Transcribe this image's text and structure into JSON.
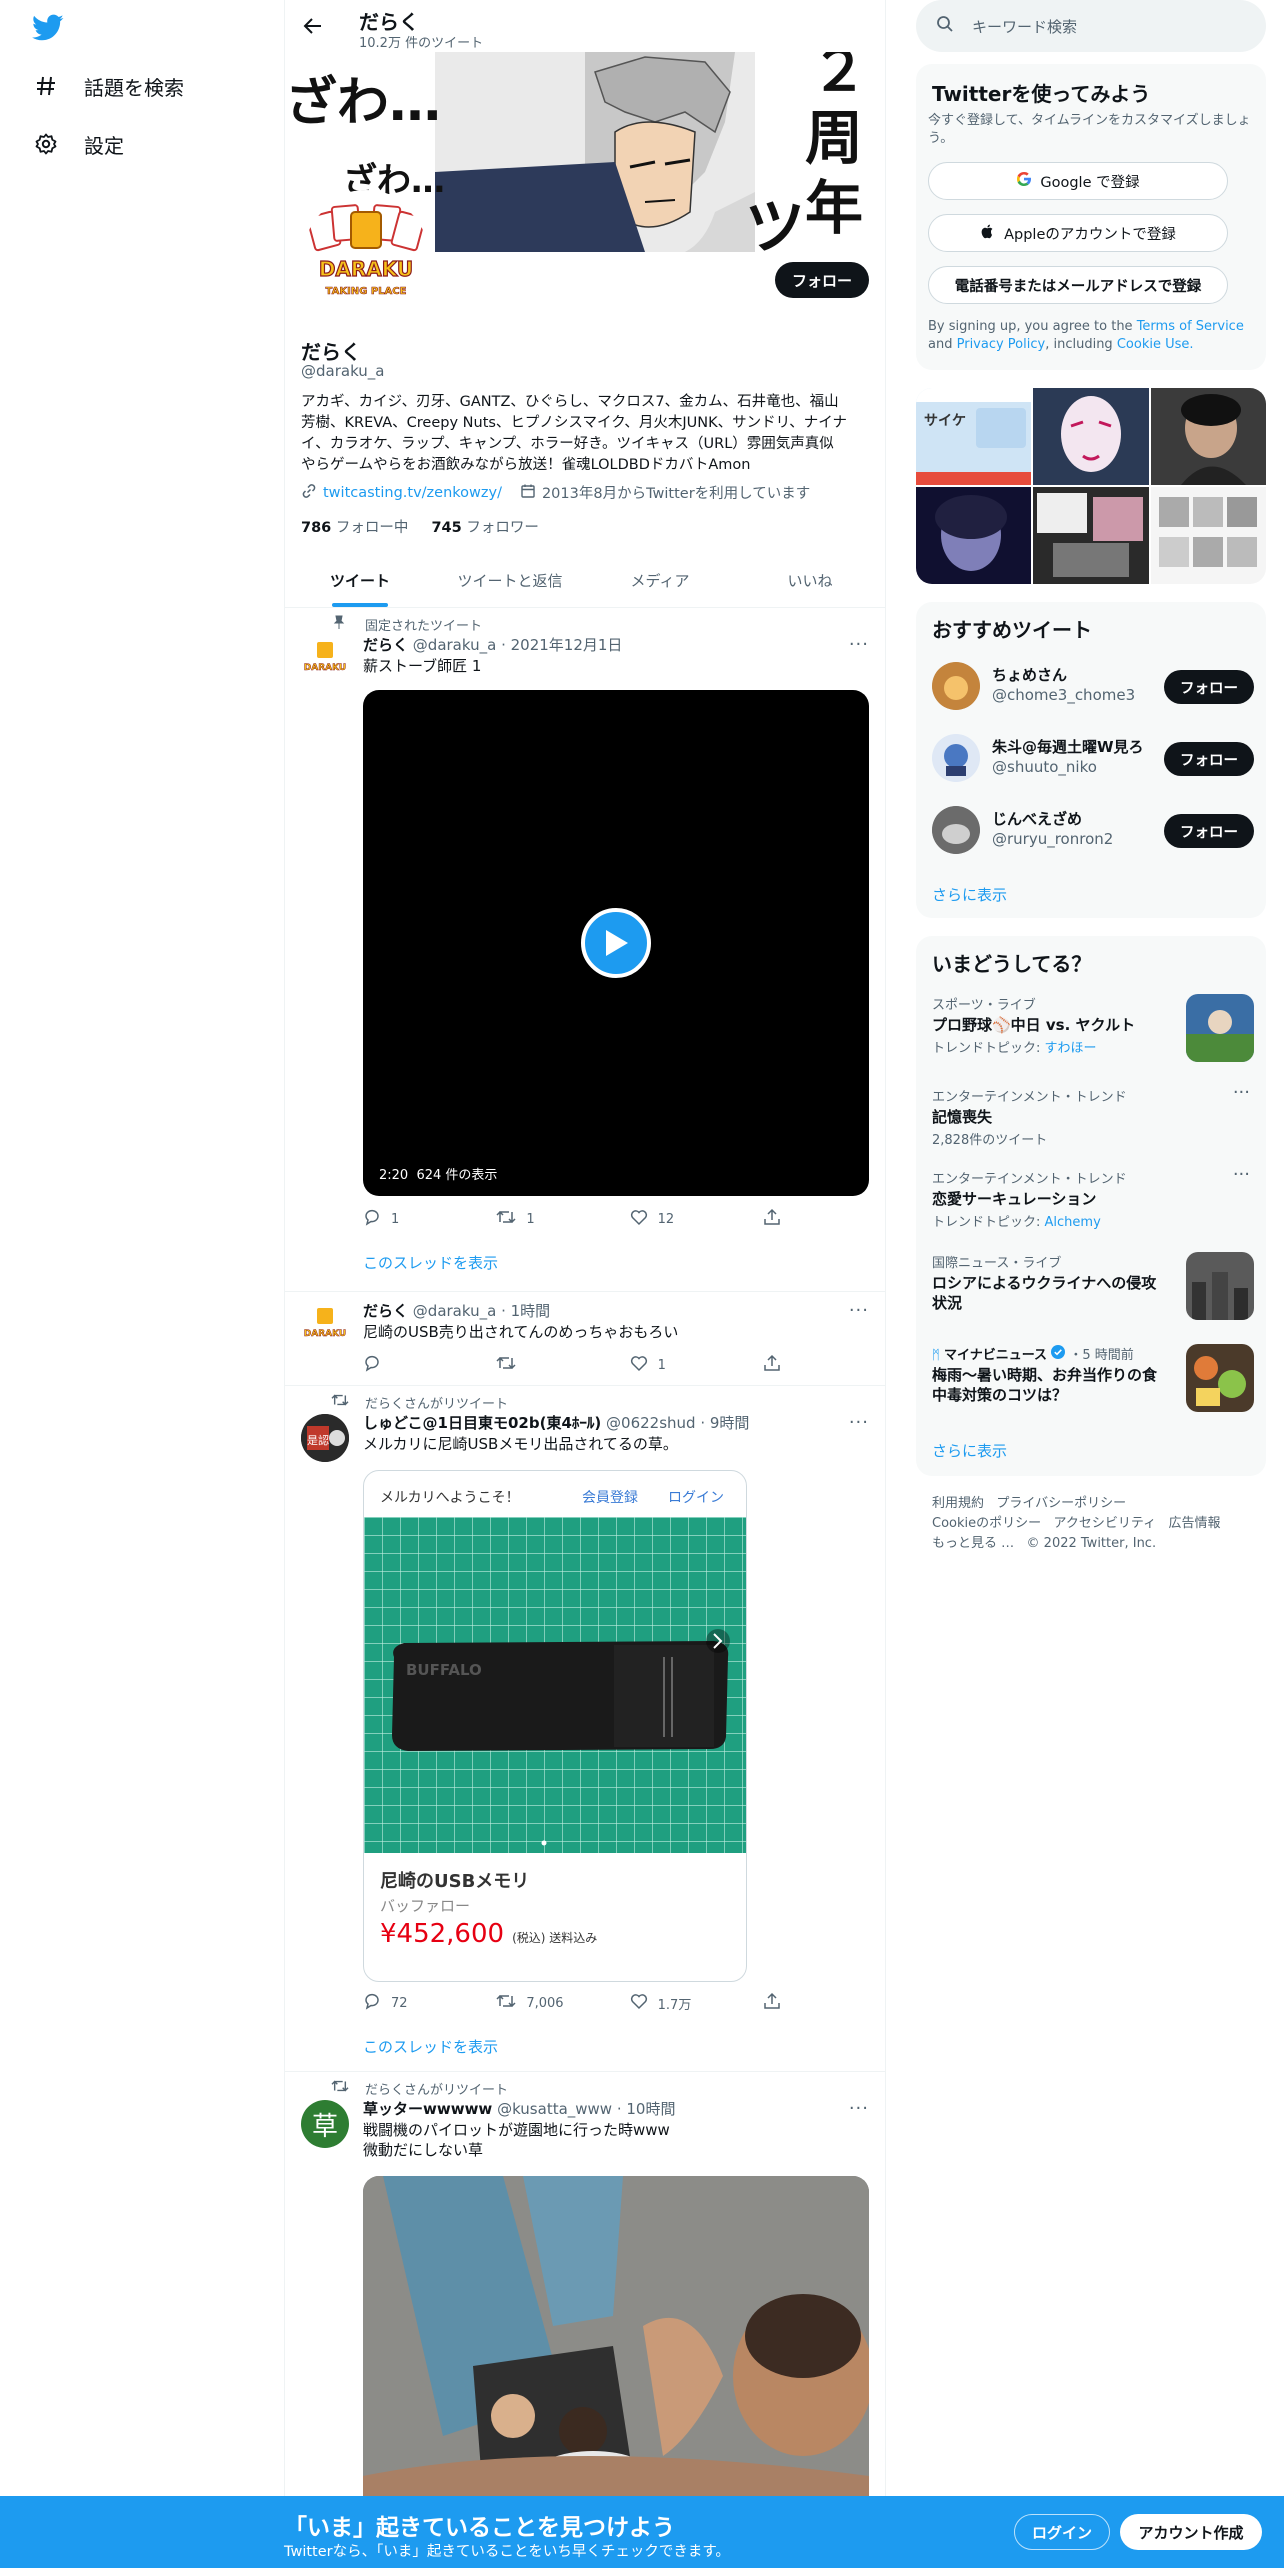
{
  "left_nav": {
    "explore_label": "話題を検索",
    "settings_label": "設定"
  },
  "header": {
    "title": "だらく",
    "tweet_count": "10.2万 件のツイート"
  },
  "banner": {
    "text_left": "ざわ…",
    "text_left2": "ざわ…",
    "text_right_1": "２",
    "text_right_2": "周",
    "text_right_3": "年",
    "text_right_4": "ツ"
  },
  "profile": {
    "logo_text": "DARAKU",
    "logo_sub": "TAKING PLACE",
    "follow_button": "フォロー",
    "name": "だらく",
    "handle": "@daraku_a",
    "bio_lines": [
      "アカギ、カイジ、刃牙、GANTZ、ひぐらし、マクロス7、金カム、石井竜也、福山",
      "芳樹、KREVA、Creepy Nuts、ヒプノシスマイク、月火木JUNK、サンドリ、ナイナ",
      "イ、カラオケ、ラップ、キャンプ、ホラー好き。ツイキャス（URL）雰囲気声真似",
      "やらゲームやらをお酒飲みながら放送！雀魂LOLDBDドカバトAmon"
    ],
    "link": "twitcasting.tv/zenkowzy/",
    "joined": "2013年8月からTwitterを利用しています",
    "following_count": "786",
    "following_label": "フォロー中",
    "followers_count": "745",
    "followers_label": "フォロワー"
  },
  "tabs": [
    "ツイート",
    "ツイートと返信",
    "メディア",
    "いいね"
  ],
  "tweets": [
    {
      "context": "固定されたツイート",
      "name": "だらく",
      "handle": "@daraku_a",
      "time": "2021年12月1日",
      "text": "薪ストーブ師匠 1",
      "video_duration": "2:20",
      "video_views": "624 件の表示",
      "replies": "1",
      "retweets": "1",
      "likes": "12",
      "thread_link": "このスレッドを表示"
    },
    {
      "name": "だらく",
      "handle": "@daraku_a",
      "time": "1時間",
      "text": "尼崎のUSB売り出されてんのめっちゃおもろい",
      "replies": "",
      "retweets": "",
      "likes": "1"
    },
    {
      "context": "だらくさんがリツイート",
      "name": "しゅどこ@1日目東モ02b(東4ﾎｰﾙ)",
      "handle": "@0622shud",
      "time": "9時間",
      "text": "メルカリに尼崎USBメモリ出品されてるの草。",
      "avatar_text": "是認",
      "card": {
        "welcome": "メルカリへようこそ！",
        "signup": "会員登録",
        "login": "ログイン",
        "item_title": "尼崎のUSBメモリ",
        "brand": "バッファロー",
        "price": "¥452,600",
        "price_note": "(税込) 送料込み",
        "usb_brand": "BUFFALO"
      },
      "replies": "72",
      "retweets": "7,006",
      "likes": "1.7万",
      "thread_link": "このスレッドを表示"
    },
    {
      "context": "だらくさんがリツイート",
      "name": "草ッターwwwww",
      "handle": "@kusatta_www",
      "time": "10時間",
      "avatar_text": "草",
      "text_lines": [
        "戦闘機のパイロットが遊園地に行った時www",
        "微動だにしない草"
      ]
    }
  ],
  "right": {
    "search_placeholder": "キーワード検索",
    "signup_card": {
      "title": "Twitterを使ってみよう",
      "subtitle_lines": [
        "今すぐ登録して、タイムラインをカスタマイズしましょ",
        "う。"
      ],
      "google": "Google で登録",
      "apple": "Appleのアカウントで登録",
      "phone": "電話番号またはメールアドレスで登録",
      "terms_prefix": "By signing up, you agree to the",
      "terms_link": "Terms of Service",
      "terms_and": "and",
      "privacy_link": "Privacy Policy",
      "including": ", including",
      "cookie_link": "Cookie Use."
    },
    "media_grid_caption": "サイケ",
    "recommended": {
      "title": "おすすめツイート",
      "users": [
        {
          "name": "ちょめさん",
          "handle": "@chome3_chome3",
          "button": "フォロー"
        },
        {
          "name": "朱斗@毎週土曜W見ろ!",
          "handle": "@shuuto_niko",
          "button": "フォロー"
        },
        {
          "name": "じんべえざめ",
          "handle": "@ruryu_ronron2",
          "button": "フォロー"
        }
      ],
      "more": "さらに表示"
    },
    "trends": {
      "title": "いまどうしてる？",
      "items": [
        {
          "category": "スポーツ・ライブ",
          "title": "プロ野球⚾中日 vs. ヤクルト",
          "sub_prefix": "トレンドトピック:",
          "sub_link": "すわほー"
        },
        {
          "category": "エンターテインメント・トレンド",
          "title": "記憶喪失",
          "sub": "2,828件のツイート"
        },
        {
          "category": "エンターテインメント・トレンド",
          "title": "恋愛サーキュレーション",
          "sub_prefix": "トレンドトピック:",
          "sub_link": "Alchemy"
        },
        {
          "category": "国際ニュース・ライブ",
          "title_lines": [
            "ロシアによるウクライナへの侵攻",
            "状況"
          ]
        },
        {
          "category_name": "マイナビニュース",
          "category_time": "・5 時間前",
          "title_lines": [
            "梅雨～暑い時期、お弁当作りの食",
            "中毒対策のコツは？"
          ]
        }
      ],
      "more": "さらに表示"
    },
    "footer": {
      "line1": [
        "利用規約",
        "プライバシーポリシー"
      ],
      "line2": [
        "Cookieのポリシー",
        "アクセシビリティ",
        "広告情報"
      ],
      "line3_more": "もっと見る …",
      "copyright": "© 2022 Twitter, Inc."
    }
  },
  "bottom_bar": {
    "headline": "「いま」起きていることを見つけよう",
    "subtext": "Twitterなら、「いま」起きていることをいち早くチェックできます。",
    "login": "ログイン",
    "signup": "アカウント作成"
  },
  "colors": {
    "accent": "#1d9bf0",
    "text": "#0f1419",
    "secondary": "#536471",
    "price_red": "#e60012"
  }
}
